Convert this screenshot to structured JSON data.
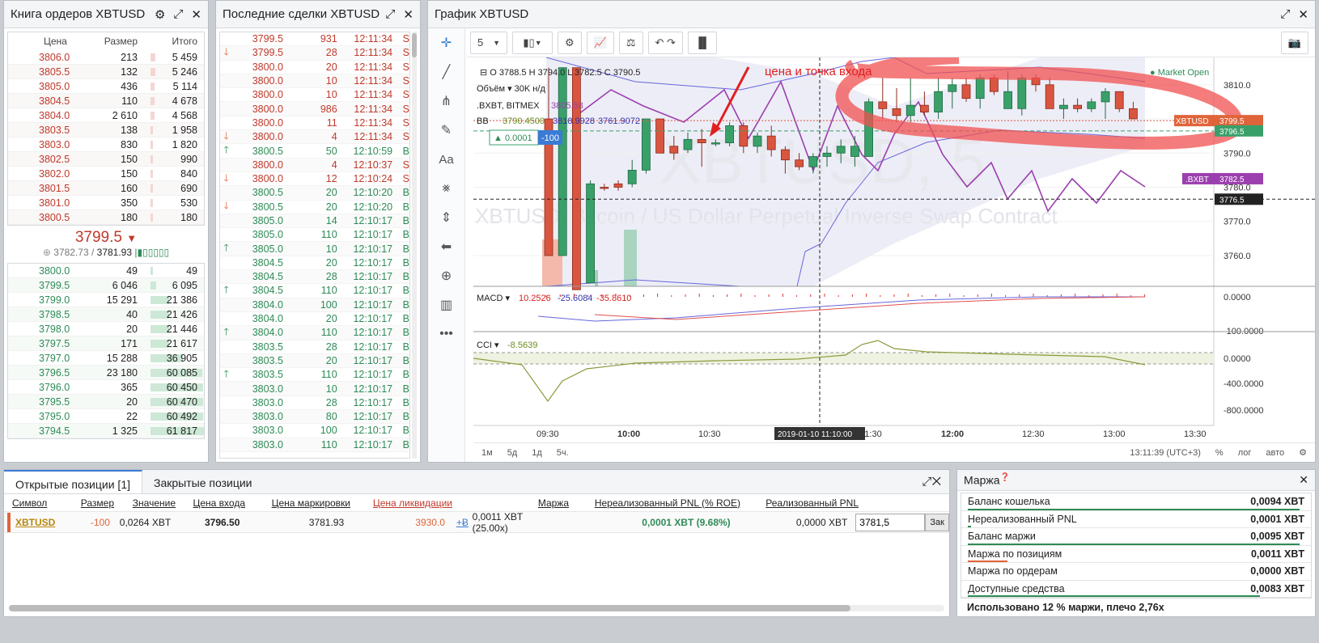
{
  "orderbook": {
    "title": "Книга ордеров XBTUSD",
    "col_price": "Цена",
    "col_size": "Размер",
    "col_total": "Итого",
    "asks": [
      {
        "price": "3806.0",
        "size": "213",
        "total": "5 459",
        "fill": 0.09
      },
      {
        "price": "3805.5",
        "size": "132",
        "total": "5 246",
        "fill": 0.09
      },
      {
        "price": "3805.0",
        "size": "436",
        "total": "5 114",
        "fill": 0.08
      },
      {
        "price": "3804.5",
        "size": "110",
        "total": "4 678",
        "fill": 0.08
      },
      {
        "price": "3804.0",
        "size": "2 610",
        "total": "4 568",
        "fill": 0.07
      },
      {
        "price": "3803.5",
        "size": "138",
        "total": "1 958",
        "fill": 0.03
      },
      {
        "price": "3803.0",
        "size": "830",
        "total": "1 820",
        "fill": 0.03
      },
      {
        "price": "3802.5",
        "size": "150",
        "total": "990",
        "fill": 0.02
      },
      {
        "price": "3802.0",
        "size": "150",
        "total": "840",
        "fill": 0.01
      },
      {
        "price": "3801.5",
        "size": "160",
        "total": "690",
        "fill": 0.01
      },
      {
        "price": "3801.0",
        "size": "350",
        "total": "530",
        "fill": 0.01
      },
      {
        "price": "3800.5",
        "size": "180",
        "total": "180",
        "fill": 0.0
      }
    ],
    "last_price": "3799.5",
    "index_price": "3782.73",
    "mark_price": "3781.93",
    "bids": [
      {
        "price": "3800.0",
        "size": "49",
        "total": "49",
        "fill": 0.0
      },
      {
        "price": "3799.5",
        "size": "6 046",
        "total": "6 095",
        "fill": 0.1
      },
      {
        "price": "3799.0",
        "size": "15 291",
        "total": "21 386",
        "fill": 0.35
      },
      {
        "price": "3798.5",
        "size": "40",
        "total": "21 426",
        "fill": 0.35
      },
      {
        "price": "3798.0",
        "size": "20",
        "total": "21 446",
        "fill": 0.35
      },
      {
        "price": "3797.5",
        "size": "171",
        "total": "21 617",
        "fill": 0.35
      },
      {
        "price": "3797.0",
        "size": "15 288",
        "total": "36 905",
        "fill": 0.6
      },
      {
        "price": "3796.5",
        "size": "23 180",
        "total": "60 085",
        "fill": 0.97
      },
      {
        "price": "3796.0",
        "size": "365",
        "total": "60 450",
        "fill": 0.98
      },
      {
        "price": "3795.5",
        "size": "20",
        "total": "60 470",
        "fill": 0.98
      },
      {
        "price": "3795.0",
        "size": "22",
        "total": "60 492",
        "fill": 0.98
      },
      {
        "price": "3794.5",
        "size": "1 325",
        "total": "61 817",
        "fill": 1.0
      }
    ]
  },
  "trades": {
    "title": "Последние сделки XBTUSD",
    "rows": [
      {
        "arrow": "",
        "price": "3799.5",
        "size": "931",
        "time": "12:11:34",
        "side": "S",
        "dir": "sell"
      },
      {
        "arrow": "down",
        "price": "3799.5",
        "size": "28",
        "time": "12:11:34",
        "side": "S",
        "dir": "sell"
      },
      {
        "arrow": "",
        "price": "3800.0",
        "size": "20",
        "time": "12:11:34",
        "side": "S",
        "dir": "sell"
      },
      {
        "arrow": "",
        "price": "3800.0",
        "size": "10",
        "time": "12:11:34",
        "side": "S",
        "dir": "sell"
      },
      {
        "arrow": "",
        "price": "3800.0",
        "size": "10",
        "time": "12:11:34",
        "side": "S",
        "dir": "sell"
      },
      {
        "arrow": "",
        "price": "3800.0",
        "size": "986",
        "time": "12:11:34",
        "side": "S",
        "dir": "sell"
      },
      {
        "arrow": "",
        "price": "3800.0",
        "size": "11",
        "time": "12:11:34",
        "side": "S",
        "dir": "sell"
      },
      {
        "arrow": "down",
        "price": "3800.0",
        "size": "4",
        "time": "12:11:34",
        "side": "S",
        "dir": "sell"
      },
      {
        "arrow": "up",
        "price": "3800.5",
        "size": "50",
        "time": "12:10:59",
        "side": "B",
        "dir": "buy"
      },
      {
        "arrow": "",
        "price": "3800.0",
        "size": "4",
        "time": "12:10:37",
        "side": "S",
        "dir": "sell"
      },
      {
        "arrow": "down",
        "price": "3800.0",
        "size": "12",
        "time": "12:10:24",
        "side": "S",
        "dir": "sell"
      },
      {
        "arrow": "",
        "price": "3800.5",
        "size": "20",
        "time": "12:10:20",
        "side": "B",
        "dir": "buy"
      },
      {
        "arrow": "down",
        "price": "3800.5",
        "size": "20",
        "time": "12:10:20",
        "side": "B",
        "dir": "buy"
      },
      {
        "arrow": "",
        "price": "3805.0",
        "size": "14",
        "time": "12:10:17",
        "side": "B",
        "dir": "buy"
      },
      {
        "arrow": "",
        "price": "3805.0",
        "size": "110",
        "time": "12:10:17",
        "side": "B",
        "dir": "buy"
      },
      {
        "arrow": "up",
        "price": "3805.0",
        "size": "10",
        "time": "12:10:17",
        "side": "B",
        "dir": "buy"
      },
      {
        "arrow": "",
        "price": "3804.5",
        "size": "20",
        "time": "12:10:17",
        "side": "B",
        "dir": "buy"
      },
      {
        "arrow": "",
        "price": "3804.5",
        "size": "28",
        "time": "12:10:17",
        "side": "B",
        "dir": "buy"
      },
      {
        "arrow": "up",
        "price": "3804.5",
        "size": "110",
        "time": "12:10:17",
        "side": "B",
        "dir": "buy"
      },
      {
        "arrow": "",
        "price": "3804.0",
        "size": "100",
        "time": "12:10:17",
        "side": "B",
        "dir": "buy"
      },
      {
        "arrow": "",
        "price": "3804.0",
        "size": "20",
        "time": "12:10:17",
        "side": "B",
        "dir": "buy"
      },
      {
        "arrow": "up",
        "price": "3804.0",
        "size": "110",
        "time": "12:10:17",
        "side": "B",
        "dir": "buy"
      },
      {
        "arrow": "",
        "price": "3803.5",
        "size": "28",
        "time": "12:10:17",
        "side": "B",
        "dir": "buy"
      },
      {
        "arrow": "",
        "price": "3803.5",
        "size": "20",
        "time": "12:10:17",
        "side": "B",
        "dir": "buy"
      },
      {
        "arrow": "up",
        "price": "3803.5",
        "size": "110",
        "time": "12:10:17",
        "side": "B",
        "dir": "buy"
      },
      {
        "arrow": "",
        "price": "3803.0",
        "size": "10",
        "time": "12:10:17",
        "side": "B",
        "dir": "buy"
      },
      {
        "arrow": "",
        "price": "3803.0",
        "size": "28",
        "time": "12:10:17",
        "side": "B",
        "dir": "buy"
      },
      {
        "arrow": "",
        "price": "3803.0",
        "size": "80",
        "time": "12:10:17",
        "side": "B",
        "dir": "buy"
      },
      {
        "arrow": "",
        "price": "3803.0",
        "size": "100",
        "time": "12:10:17",
        "side": "B",
        "dir": "buy"
      },
      {
        "arrow": "",
        "price": "3803.0",
        "size": "110",
        "time": "12:10:17",
        "side": "B",
        "dir": "buy"
      }
    ]
  },
  "chart": {
    "title": "График XBTUSD",
    "interval": "5",
    "ohlc": {
      "o": "O",
      "o_val": "3788.5",
      "h": "H",
      "h_val": "3794.0",
      "l": "L",
      "l_val": "3782.5",
      "c": "C",
      "c_val": "3790.5"
    },
    "volume_label": "Объём",
    "volume_value": "30K",
    "volume_na": "н/д",
    "index_label": ".BXBT, BITMEX",
    "index_value": "3805.58",
    "bb_label": "BB",
    "bb_values": [
      "3790.4500",
      "3818.9928",
      "3761.9072"
    ],
    "position_qty": "▲ 0.0001",
    "position_size": "-100",
    "watermark_sym": "XBTUSD, 5",
    "watermark_desc": "XBTUSD: Bitcoin / US Dollar Perpetual Inverse Swap Contract",
    "market_open": "● Market Open",
    "annotation": "цена и точка входа",
    "price_axis": [
      "3810.0",
      "3800.0",
      "3790.0",
      "3780.0",
      "3770.0",
      "3760.0"
    ],
    "tag_xbtusd": "XBTUSD",
    "tag_xbtusd_val": "3799.5",
    "tag_entry": "3796.5",
    "tag_bxbt": ".BXBT",
    "tag_bxbt_val": "3782.5",
    "tag_dash": "3776.5",
    "macd_label": "MACD",
    "macd_values": [
      "10.2526",
      "-25.6084",
      "-35.8610"
    ],
    "macd_axis": [
      "0.0000",
      "-100.0000"
    ],
    "cci_label": "CCI",
    "cci_value": "-8.5639",
    "cci_axis": [
      "0.0000",
      "-400.0000",
      "-800.0000"
    ],
    "time_axis": [
      "09:30",
      "10:00",
      "10:30",
      "11:30",
      "12:00",
      "12:30",
      "13:00",
      "13:30"
    ],
    "crosshair_time": "2019-01-10 11:10:00",
    "ranges": [
      "1м",
      "5д",
      "1д",
      "5ч."
    ],
    "clock": "13:11:39 (UTC+3)",
    "scale_opts": [
      "%",
      "лог",
      "авто"
    ],
    "candles": [
      {
        "o": 3800,
        "h": 3815,
        "l": 3770,
        "c": 3760,
        "col": "red"
      },
      {
        "o": 3760,
        "h": 3815,
        "l": 3780,
        "c": 3815,
        "col": "green"
      },
      {
        "o": 3815,
        "h": 3815,
        "l": 3750,
        "c": 3750,
        "col": "red"
      },
      {
        "o": 3752,
        "h": 3782,
        "l": 3752,
        "c": 3781,
        "col": "green"
      },
      {
        "o": 3780,
        "h": 3781,
        "l": 3779,
        "c": 3780,
        "col": "red"
      },
      {
        "o": 3780,
        "h": 3782,
        "l": 3779,
        "c": 3781,
        "col": "red"
      },
      {
        "o": 3781,
        "h": 3788,
        "l": 3780,
        "c": 3785,
        "col": "green"
      },
      {
        "o": 3785,
        "h": 3800,
        "l": 3784,
        "c": 3800,
        "col": "green"
      },
      {
        "o": 3800,
        "h": 3800,
        "l": 3790,
        "c": 3790,
        "col": "red"
      },
      {
        "o": 3790,
        "h": 3795,
        "l": 3788,
        "c": 3792,
        "col": "red"
      },
      {
        "o": 3791,
        "h": 3796,
        "l": 3790,
        "c": 3794,
        "col": "green"
      },
      {
        "o": 3794,
        "h": 3797,
        "l": 3786,
        "c": 3793,
        "col": "red"
      },
      {
        "o": 3793,
        "h": 3794,
        "l": 3792,
        "c": 3793,
        "col": "green"
      },
      {
        "o": 3793,
        "h": 3799,
        "l": 3792,
        "c": 3798,
        "col": "green"
      },
      {
        "o": 3798,
        "h": 3799,
        "l": 3790,
        "c": 3792,
        "col": "red"
      },
      {
        "o": 3792,
        "h": 3796,
        "l": 3790,
        "c": 3795,
        "col": "green"
      },
      {
        "o": 3795,
        "h": 3798,
        "l": 3789,
        "c": 3791,
        "col": "red"
      },
      {
        "o": 3791,
        "h": 3792,
        "l": 3784,
        "c": 3788,
        "col": "red"
      },
      {
        "o": 3788,
        "h": 3790,
        "l": 3785,
        "c": 3786,
        "col": "red"
      },
      {
        "o": 3786,
        "h": 3790,
        "l": 3784,
        "c": 3789,
        "col": "green"
      },
      {
        "o": 3789,
        "h": 3792,
        "l": 3786,
        "c": 3790,
        "col": "green"
      },
      {
        "o": 3790,
        "h": 3794,
        "l": 3787,
        "c": 3792,
        "col": "green"
      },
      {
        "o": 3792,
        "h": 3795,
        "l": 3786,
        "c": 3789,
        "col": "green"
      },
      {
        "o": 3789,
        "h": 3806,
        "l": 3789,
        "c": 3805,
        "col": "green"
      },
      {
        "o": 3805,
        "h": 3812,
        "l": 3800,
        "c": 3803,
        "col": "red"
      },
      {
        "o": 3803,
        "h": 3809,
        "l": 3799,
        "c": 3801,
        "col": "red"
      },
      {
        "o": 3801,
        "h": 3812,
        "l": 3799,
        "c": 3804,
        "col": "green"
      },
      {
        "o": 3804,
        "h": 3808,
        "l": 3801,
        "c": 3802,
        "col": "red"
      },
      {
        "o": 3802,
        "h": 3812,
        "l": 3800,
        "c": 3808,
        "col": "green"
      },
      {
        "o": 3808,
        "h": 3812,
        "l": 3803,
        "c": 3810,
        "col": "green"
      },
      {
        "o": 3810,
        "h": 3812,
        "l": 3805,
        "c": 3806,
        "col": "red"
      },
      {
        "o": 3806,
        "h": 3813,
        "l": 3803,
        "c": 3812,
        "col": "green"
      },
      {
        "o": 3812,
        "h": 3813,
        "l": 3807,
        "c": 3808,
        "col": "red"
      },
      {
        "o": 3808,
        "h": 3814,
        "l": 3803,
        "c": 3803,
        "col": "green"
      },
      {
        "o": 3803,
        "h": 3813,
        "l": 3801,
        "c": 3812,
        "col": "green"
      },
      {
        "o": 3812,
        "h": 3813,
        "l": 3808,
        "c": 3810,
        "col": "red"
      },
      {
        "o": 3810,
        "h": 3812,
        "l": 3803,
        "c": 3803,
        "col": "red"
      },
      {
        "o": 3803,
        "h": 3806,
        "l": 3800,
        "c": 3804,
        "col": "green"
      },
      {
        "o": 3804,
        "h": 3806,
        "l": 3802,
        "c": 3803,
        "col": "red"
      },
      {
        "o": 3803,
        "h": 3806,
        "l": 3802,
        "c": 3805,
        "col": "green"
      },
      {
        "o": 3805,
        "h": 3809,
        "l": 3800,
        "c": 3808,
        "col": "green"
      },
      {
        "o": 3808,
        "h": 3808,
        "l": 3802,
        "c": 3803,
        "col": "red"
      },
      {
        "o": 3803,
        "h": 3805,
        "l": 3800,
        "c": 3800,
        "col": "red"
      }
    ]
  },
  "positions": {
    "tab_open": "Открытые позиции [1]",
    "tab_closed": "Закрытые позиции",
    "headers": [
      "Символ",
      "Размер",
      "Значение",
      "Цена входа",
      "Цена маркировки",
      "Цена ликвидации",
      "Маржа",
      "Нереализованный PNL (% ROE)",
      "Реализованный PNL"
    ],
    "row": {
      "symbol": "XBTUSD",
      "size": "-100",
      "value": "0,0264 XBT",
      "entry": "3796.50",
      "mark": "3781.93",
      "liq": "3930.0",
      "margin_btn": "+Ƀ",
      "margin": "0,0011 XBT (25.00x)",
      "upnl": "0,0001 XBT (9.68%)",
      "rpnl": "0,0000 XBT",
      "close_input": "3781,5",
      "close_btn": "Зак"
    }
  },
  "margin": {
    "title": "Маржа",
    "rows": [
      {
        "label": "Баланс кошелька",
        "value": "0,0094 XBT",
        "bar": 1.0,
        "color": "#2e8b57"
      },
      {
        "label": "Нереализованный PNL",
        "value": "0,0001 XBT",
        "bar": 0.01,
        "color": "#2e8b57"
      },
      {
        "label": "Баланс маржи",
        "value": "0,0095 XBT",
        "bar": 1.0,
        "color": "#2e8b57"
      },
      {
        "label": "Маржа по позициям",
        "value": "0,0011 XBT",
        "bar": 0.12,
        "color": "#e0643a"
      },
      {
        "label": "Маржа по ордерам",
        "value": "0,0000 XBT",
        "bar": 0.0,
        "color": "#2e8b57"
      },
      {
        "label": "Доступные средства",
        "value": "0,0083 XBT",
        "bar": 0.88,
        "color": "#2e8b57"
      }
    ],
    "footer": "Использовано 12 % маржи, плечо 2,76x"
  }
}
